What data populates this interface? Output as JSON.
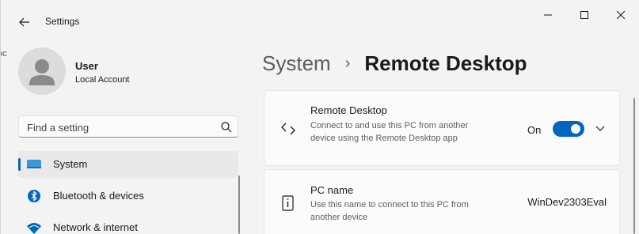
{
  "window": {
    "app_title": "Settings",
    "edge_text": "oc"
  },
  "user": {
    "name": "User",
    "account_type": "Local Account"
  },
  "search": {
    "placeholder": "Find a setting",
    "value": ""
  },
  "sidebar": {
    "items": [
      {
        "label": "System",
        "icon": "system-icon",
        "selected": true
      },
      {
        "label": "Bluetooth & devices",
        "icon": "bluetooth-icon",
        "selected": false
      },
      {
        "label": "Network & internet",
        "icon": "wifi-icon",
        "selected": false
      }
    ]
  },
  "breadcrumb": {
    "parent": "System",
    "separator": "›",
    "current": "Remote Desktop"
  },
  "remote_desktop": {
    "title": "Remote Desktop",
    "description": "Connect to and use this PC from another device using the Remote Desktop app",
    "toggle_state_label": "On",
    "toggle_on": true
  },
  "pc_name": {
    "title": "PC name",
    "description": "Use this name to connect to this PC from another device",
    "value": "WinDev2303Eval"
  },
  "colors": {
    "accent": "#0067c0",
    "window_bg": "#f3f3f3",
    "card_bg": "#fbfbfb"
  }
}
